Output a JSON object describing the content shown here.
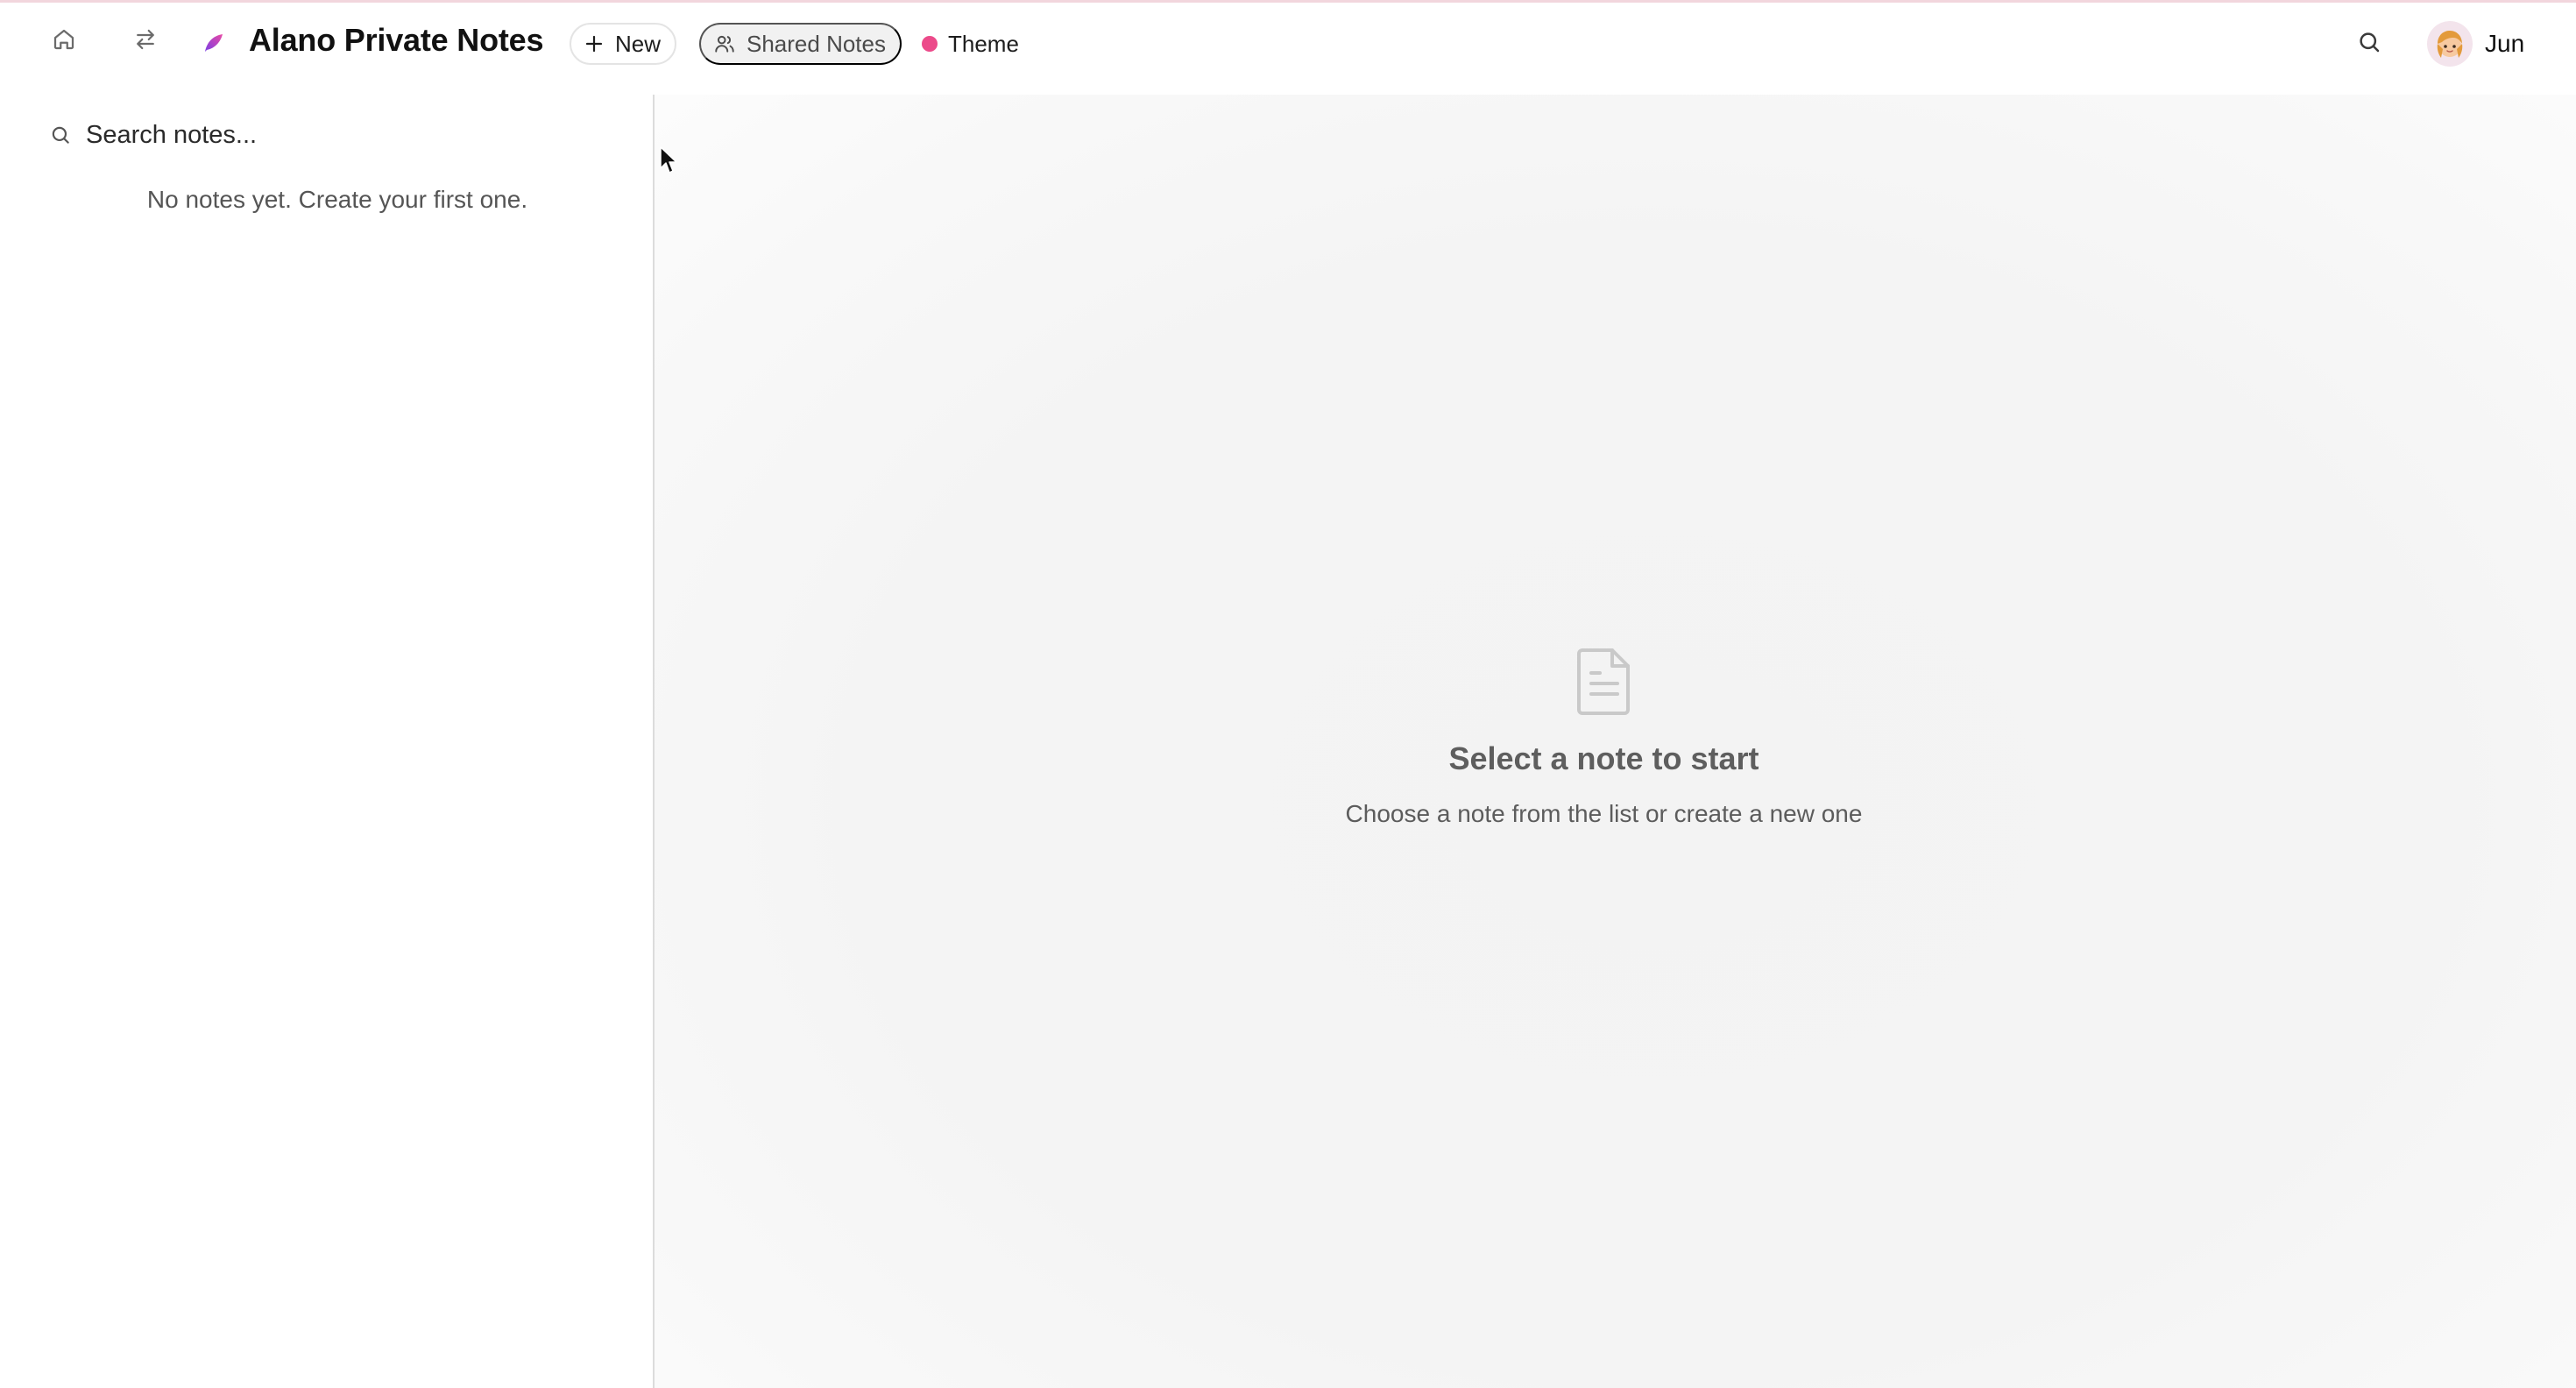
{
  "header": {
    "app_title": "Alano Private Notes",
    "new_label": "New",
    "shared_label": "Shared Notes",
    "theme_label": "Theme",
    "user_name": "Jun",
    "theme_color": "#ec4a8a",
    "icons": {
      "home": "home-icon",
      "switch": "switch-arrows-icon",
      "brand": "feather-logo-icon",
      "new": "plus-icon",
      "shared": "users-icon",
      "search": "search-icon",
      "avatar": "avatar-icon"
    }
  },
  "sidebar": {
    "search_placeholder": "Search notes...",
    "empty_text": "No notes yet. Create your first one."
  },
  "main": {
    "empty_title": "Select a note to start",
    "empty_subtitle": "Choose a note from the list or create a new one",
    "icon": "document-icon"
  }
}
